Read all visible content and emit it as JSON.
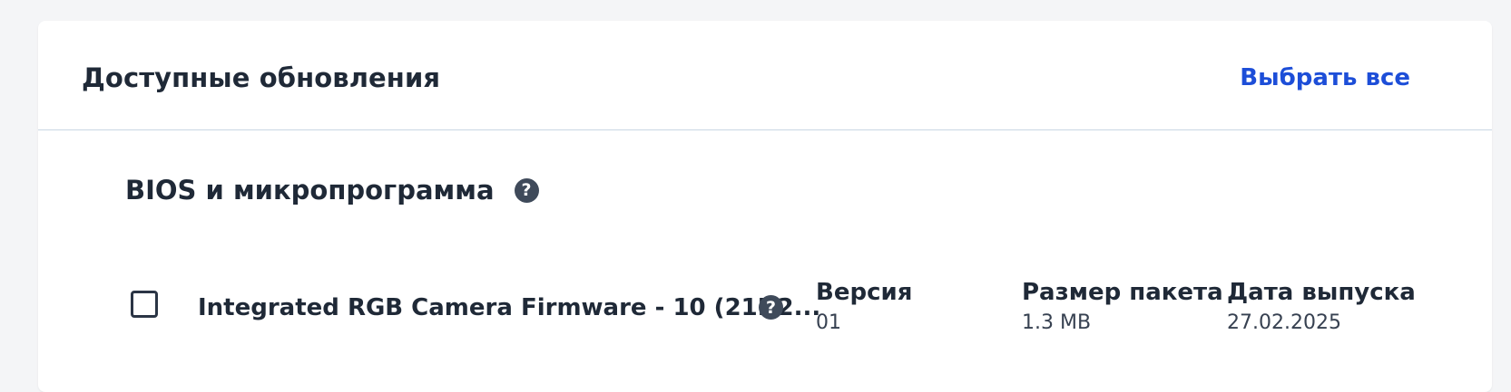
{
  "header": {
    "title": "Доступные обновления",
    "select_all_label": "Выбрать все"
  },
  "section": {
    "title": "BIOS и микропрограмма",
    "help_icon": "question-circle-icon"
  },
  "updates": [
    {
      "name": "Integrated RGB Camera Firmware - 10 (21H2...",
      "checked": false,
      "help_icon": "question-circle-icon",
      "version_label": "Версия",
      "version": "01",
      "size_label": "Размер пакета",
      "size": "1.3 MB",
      "date_label": "Дата выпуска",
      "date": "27.02.2025"
    }
  ],
  "colors": {
    "accent": "#1d4ed8",
    "icon_bg": "#3f4a5a",
    "divider": "#c9d6e3",
    "page_bg": "#f4f5f7"
  }
}
